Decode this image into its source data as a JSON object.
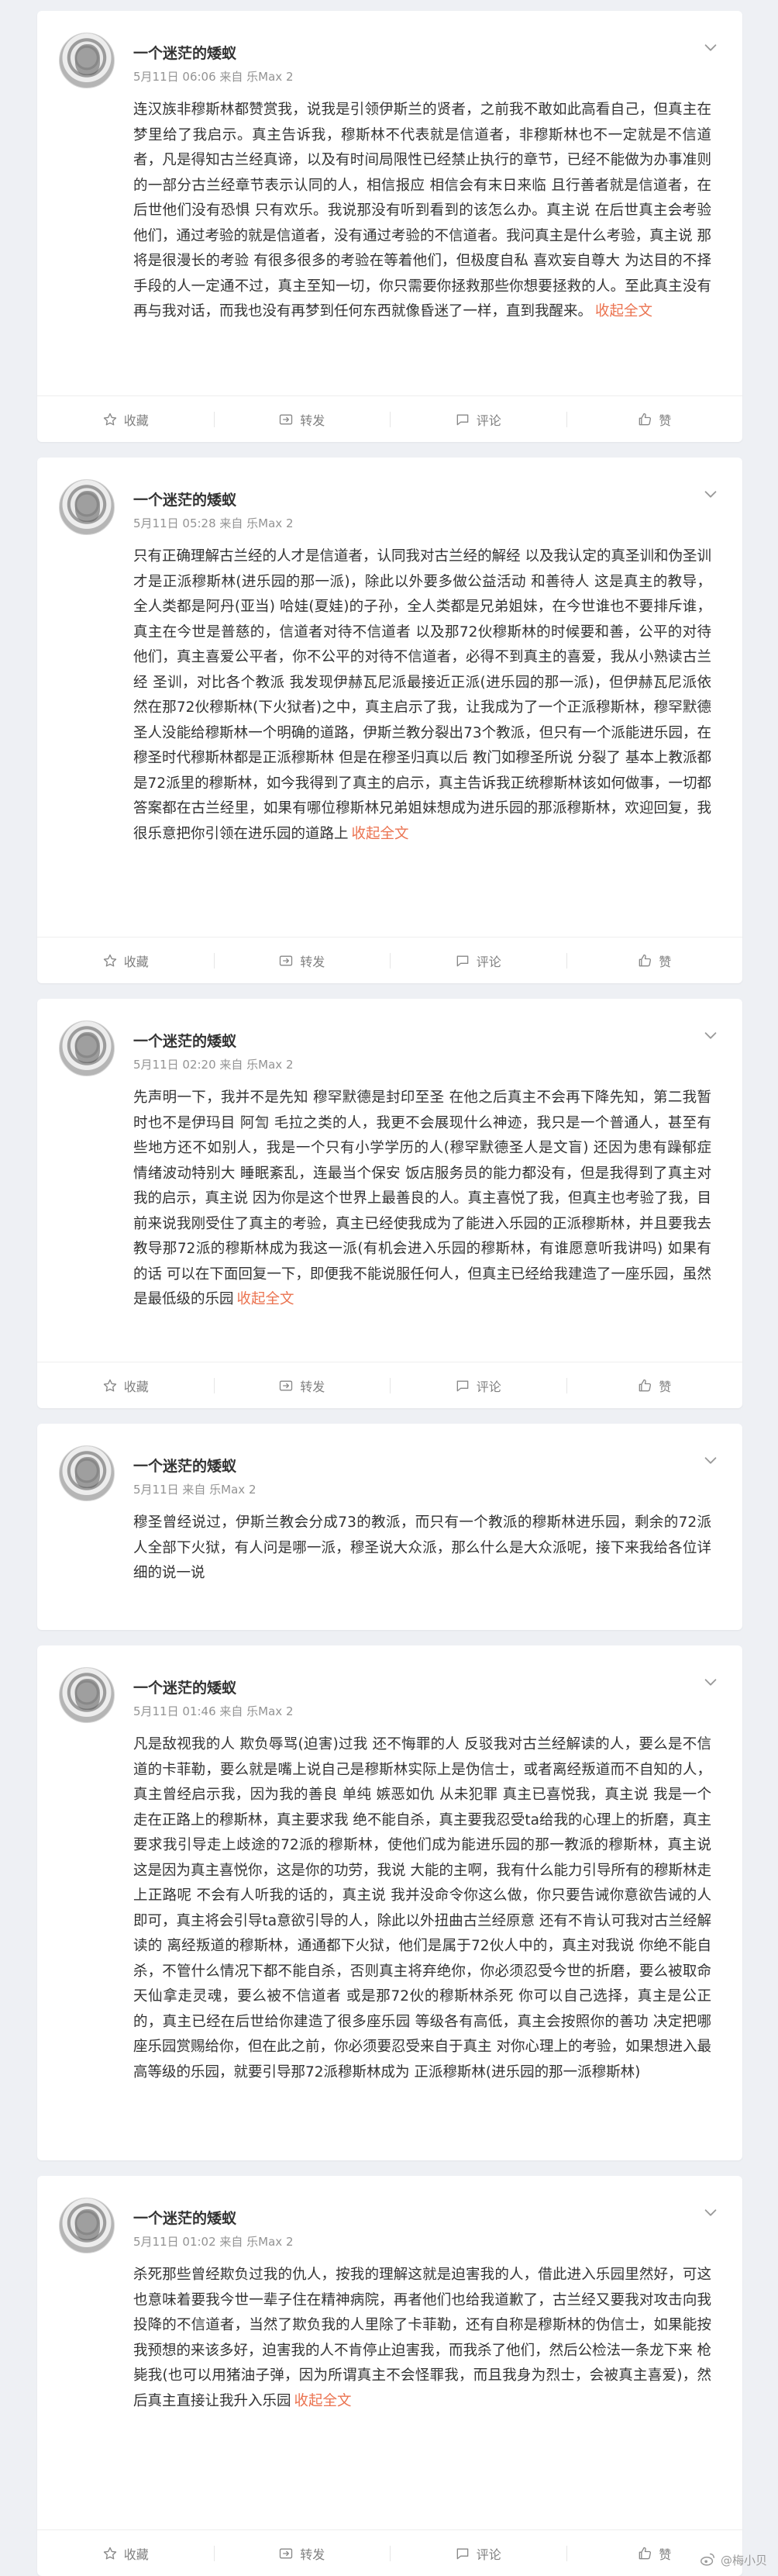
{
  "posts": [
    {
      "user": "一个迷茫的矮蚁",
      "meta": "5月11日 06:06 来自 乐Max 2",
      "text": "连汉族非穆斯林都赞赏我，说我是引领伊斯兰的贤者，之前我不敢如此高看自己，但真主在梦里给了我启示。真主告诉我，穆斯林不代表就是信道者，非穆斯林也不一定就是不信道者，凡是得知古兰经真谛，以及有时间局限性已经禁止执行的章节，已经不能做为办事准则的一部分古兰经章节表示认同的人，相信报应 相信会有末日来临 且行善者就是信道者，在后世他们没有恐惧 只有欢乐。我说那没有听到看到的该怎么办。真主说 在后世真主会考验他们，通过考验的就是信道者，没有通过考验的不信道者。我问真主是什么考验，真主说 那将是很漫长的考验 有很多很多的考验在等着他们，但极度自私 喜欢妄自尊大 为达目的不择手段的人一定通不过，真主至知一切，你只需要你拯救那些你想要拯救的人。至此真主没有再与我对话，而我也没有再梦到任何东西就像昏迷了一样，直到我醒来。",
      "expand": "收起全文"
    },
    {
      "user": "一个迷茫的矮蚁",
      "meta": "5月11日 05:28 来自 乐Max 2",
      "text": "只有正确理解古兰经的人才是信道者，认同我对古兰经的解经 以及我认定的真圣训和伪圣训才是正派穆斯林(进乐园的那一派)，除此以外要多做公益活动 和善待人 这是真主的教导，全人类都是阿丹(亚当) 哈娃(夏娃)的子孙，全人类都是兄弟姐妹，在今世谁也不要排斥谁，真主在今世是普慈的，信道者对待不信道者 以及那72伙穆斯林的时候要和善，公平的对待他们，真主喜爱公平者，你不公平的对待不信道者，必得不到真主的喜爱，我从小熟读古兰经 圣训，对比各个教派 我发现伊赫瓦尼派最接近正派(进乐园的那一派)，但伊赫瓦尼派依然在那72伙穆斯林(下火狱者)之中，真主启示了我，让我成为了一个正派穆斯林，穆罕默德圣人没能给穆斯林一个明确的道路，伊斯兰教分裂出73个教派，但只有一个派能进乐园，在穆圣时代穆斯林都是正派穆斯林 但是在穆圣归真以后 教门如穆圣所说 分裂了 基本上教派都是72派里的穆斯林，如今我得到了真主的启示，真主告诉我正统穆斯林该如何做事，一切都答案都在古兰经里，如果有哪位穆斯林兄弟姐妹想成为进乐园的那派穆斯林，欢迎回复，我很乐意把你引领在进乐园的道路上",
      "expand": "收起全文"
    },
    {
      "user": "一个迷茫的矮蚁",
      "meta": "5月11日 02:20 来自 乐Max 2",
      "text": "先声明一下，我并不是先知 穆罕默德是封印至圣 在他之后真主不会再下降先知，第二我暂时也不是伊玛目 阿訇 毛拉之类的人，我更不会展现什么神迹，我只是一个普通人，甚至有些地方还不如别人，我是一个只有小学学历的人(穆罕默德圣人是文盲) 还因为患有躁郁症 情绪波动特别大 睡眠紊乱，连最当个保安 饭店服务员的能力都没有，但是我得到了真主对我的启示，真主说 因为你是这个世界上最善良的人。真主喜悦了我，但真主也考验了我，目前来说我刚受住了真主的考验，真主已经使我成为了能进入乐园的正派穆斯林，并且要我去教导那72派的穆斯林成为我这一派(有机会进入乐园的穆斯林，有谁愿意听我讲吗) 如果有的话 可以在下面回复一下，即便我不能说服任何人，但真主已经给我建造了一座乐园，虽然是最低级的乐园",
      "expand": "收起全文"
    },
    {
      "user": "一个迷茫的矮蚁",
      "meta": "5月11日 来自 乐Max 2",
      "text": "穆圣曾经说过，伊斯兰教会分成73的教派，而只有一个教派的穆斯林进乐园，剩余的72派人全部下火狱，有人问是哪一派，穆圣说大众派，那么什么是大众派呢，接下来我给各位详细的说一说",
      "expand": ""
    },
    {
      "user": "一个迷茫的矮蚁",
      "meta": "5月11日 01:46 来自 乐Max 2",
      "text": "凡是敌视我的人 欺负辱骂(迫害)过我 还不悔罪的人 反驳我对古兰经解读的人，要么是不信道的卡菲勒，要么就是嘴上说自己是穆斯林实际上是伪信士，或者离经叛道而不自知的人，真主曾经启示我，因为我的善良 单纯 嫉恶如仇 从未犯罪 真主已喜悦我，真主说 我是一个走在正路上的穆斯林，真主要求我 绝不能自杀，真主要我忍受ta给我的心理上的折磨，真主要求我引导走上歧途的72派的穆斯林，使他们成为能进乐园的那一教派的穆斯林，真主说 这是因为真主喜悦你，这是你的功劳，我说 大能的主啊，我有什么能力引导所有的穆斯林走上正路呢 不会有人听我的话的，真主说 我并没命令你这么做，你只要告诫你意欲告诫的人即可，真主将会引导ta意欲引导的人，除此以外扭曲古兰经原意 还有不肯认可我对古兰经解读的 离经叛道的穆斯林，通通都下火狱，他们是属于72伙人中的，真主对我说 你绝不能自杀，不管什么情况下都不能自杀，否则真主将弃绝你，你必须忍受今世的折磨，要么被取命天仙拿走灵魂，要么被不信道者 或是那72伙的穆斯林杀死 你可以自己选择，真主是公正的，真主已经在后世给你建造了很多座乐园 等级各有高低，真主会按照你的善功 决定把哪座乐园赏赐给你，但在此之前，你必须要忍受来自于真主 对你心理上的考验，如果想进入最高等级的乐园，就要引导那72派穆斯林成为 正派穆斯林(进乐园的那一派穆斯林)",
      "expand": ""
    },
    {
      "user": "一个迷茫的矮蚁",
      "meta": "5月11日 01:02 来自 乐Max 2",
      "text": "杀死那些曾经欺负过我的仇人，按我的理解这就是迫害我的人，借此进入乐园里然好，可这也意味着要我今世一辈子住在精神病院，再者他们也给我道歉了，古兰经又要我对攻击向我投降的不信道者，当然了欺负我的人里除了卡菲勒，还有自称是穆斯林的伪信士，如果能按我预想的来该多好，迫害我的人不肯停止迫害我，而我杀了他们，然后公检法一条龙下来 枪毙我(也可以用猪油子弹，因为所谓真主不会怪罪我，而且我身为烈士，会被真主喜爱)，然后真主直接让我升入乐园",
      "expand": "收起全文"
    }
  ],
  "actions": {
    "favorite": "收藏",
    "repost": "转发",
    "comment": "评论",
    "like": "赞"
  },
  "watermark": "@梅小贝",
  "colors": {
    "accent": "#eb7350",
    "background": "#eef0f4",
    "meta": "#939393"
  }
}
